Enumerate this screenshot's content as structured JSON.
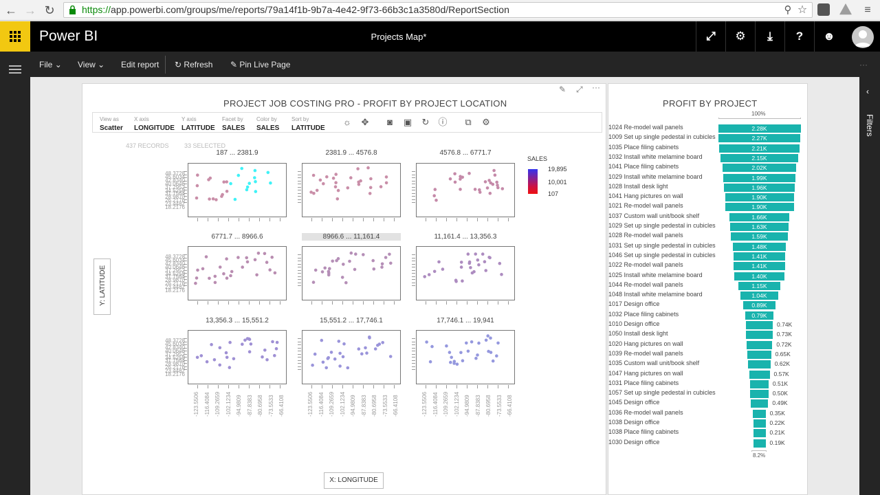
{
  "browser": {
    "url_scheme": "https://",
    "url_rest": "app.powerbi.com/groups/me/reports/79a14f1b-9b7a-4e42-9f73-66b3c1a3580d/ReportSection"
  },
  "header": {
    "brand": "Power BI",
    "report_title": "Projects Map*"
  },
  "commands": {
    "file": "File",
    "view": "View",
    "edit": "Edit report",
    "refresh": "Refresh",
    "pin": "Pin Live Page"
  },
  "filters_label": "Filters",
  "scatter": {
    "title": "PROJECT JOB COSTING PRO - PROFIT BY PROJECT LOCATION",
    "controls": [
      {
        "label": "View as",
        "value": "Scatter"
      },
      {
        "label": "X axis",
        "value": "LONGITUDE"
      },
      {
        "label": "Y axis",
        "value": "LATITUDE"
      },
      {
        "label": "Facet by",
        "value": "SALES"
      },
      {
        "label": "Color by",
        "value": "SALES"
      },
      {
        "label": "Sort by",
        "value": "LATITUDE"
      }
    ],
    "records": "437 RECORDS",
    "selected": "33 SELECTED",
    "y_axis_label": "Y: LATITUDE",
    "x_axis_label": "X: LONGITUDE",
    "legend_title": "SALES",
    "legend_values": [
      "19,895",
      "10,001",
      "107"
    ],
    "facets": [
      "187 ... 2381.9",
      "2381.9 ... 4576.8",
      "4576.8 ... 6771.7",
      "6771.7 ... 8966.6",
      "8966.6 ... 11,161.4",
      "11,161.4 ... 13,356.3",
      "13,356.3 ... 15,551.2",
      "15,551.2 ... 17,746.1",
      "17,746.1 ... 19,941"
    ],
    "y_ticks": [
      "48.3728",
      "45.6034",
      "42.8340",
      "40.0646",
      "37.2952",
      "34.5258",
      "31.7564",
      "28.9870",
      "26.2176",
      "23.4482",
      "18.2176"
    ],
    "x_ticks": [
      "-123.5506",
      "-116.4084",
      "-109.2659",
      "-102.1234",
      "-94.9809",
      "-87.8383",
      "-80.6958",
      "-73.5533",
      "-66.4108"
    ]
  },
  "funnel": {
    "title": "PROFIT BY PROJECT",
    "top_pct": "100%",
    "bottom_pct": "8.2%",
    "rows": [
      {
        "label": "1024 Re-model wall panels",
        "value": 2.28,
        "text": "2.28K"
      },
      {
        "label": "1009 Set up single pedestal in cubicles",
        "value": 2.27,
        "text": "2.27K"
      },
      {
        "label": "1035 Place filing cabinets",
        "value": 2.21,
        "text": "2.21K"
      },
      {
        "label": "1032 Install white melamine board",
        "value": 2.15,
        "text": "2.15K"
      },
      {
        "label": "1041 Place filing cabinets",
        "value": 2.02,
        "text": "2.02K"
      },
      {
        "label": "1029 Install white melamine board",
        "value": 1.99,
        "text": "1.99K"
      },
      {
        "label": "1028 Install desk light",
        "value": 1.96,
        "text": "1.96K"
      },
      {
        "label": "1041 Hang pictures on wall",
        "value": 1.9,
        "text": "1.90K"
      },
      {
        "label": "1021 Re-model wall panels",
        "value": 1.9,
        "text": "1.90K"
      },
      {
        "label": "1037 Custom wall unit/book shelf",
        "value": 1.66,
        "text": "1.66K"
      },
      {
        "label": "1029 Set up single pedestal in cubicles",
        "value": 1.63,
        "text": "1.63K"
      },
      {
        "label": "1028 Re-model wall panels",
        "value": 1.59,
        "text": "1.59K"
      },
      {
        "label": "1031 Set up single pedestal in cubicles",
        "value": 1.48,
        "text": "1.48K"
      },
      {
        "label": "1046 Set up single pedestal in cubicles",
        "value": 1.41,
        "text": "1.41K"
      },
      {
        "label": "1022 Re-model wall panels",
        "value": 1.41,
        "text": "1.41K"
      },
      {
        "label": "1025 Install white melamine board",
        "value": 1.4,
        "text": "1.40K"
      },
      {
        "label": "1044 Re-model wall panels",
        "value": 1.15,
        "text": "1.15K"
      },
      {
        "label": "1048 Install white melamine board",
        "value": 1.04,
        "text": "1.04K"
      },
      {
        "label": "1017 Design office",
        "value": 0.89,
        "text": "0.89K"
      },
      {
        "label": "1032 Place filing cabinets",
        "value": 0.79,
        "text": "0.79K"
      },
      {
        "label": "1010 Design office",
        "value": 0.74,
        "text": "0.74K"
      },
      {
        "label": "1050 Install desk light",
        "value": 0.73,
        "text": "0.73K"
      },
      {
        "label": "1020 Hang pictures on wall",
        "value": 0.72,
        "text": "0.72K"
      },
      {
        "label": "1039 Re-model wall panels",
        "value": 0.65,
        "text": "0.65K"
      },
      {
        "label": "1035 Custom wall unit/book shelf",
        "value": 0.62,
        "text": "0.62K"
      },
      {
        "label": "1047 Hang pictures on wall",
        "value": 0.57,
        "text": "0.57K"
      },
      {
        "label": "1031 Place filing cabinets",
        "value": 0.51,
        "text": "0.51K"
      },
      {
        "label": "1057 Set up single pedestal in cubicles",
        "value": 0.5,
        "text": "0.50K"
      },
      {
        "label": "1045 Design office",
        "value": 0.49,
        "text": "0.49K"
      },
      {
        "label": "1036 Re-model wall panels",
        "value": 0.35,
        "text": "0.35K"
      },
      {
        "label": "1038 Design office",
        "value": 0.22,
        "text": "0.22K"
      },
      {
        "label": "1038 Place filing cabinets",
        "value": 0.21,
        "text": "0.21K"
      },
      {
        "label": "1030 Design office",
        "value": 0.19,
        "text": "0.19K"
      }
    ]
  },
  "colors": {
    "funnel": "#19b3ad",
    "selected_point": "#3ff2f7",
    "brand_yellow": "#f2c811"
  }
}
